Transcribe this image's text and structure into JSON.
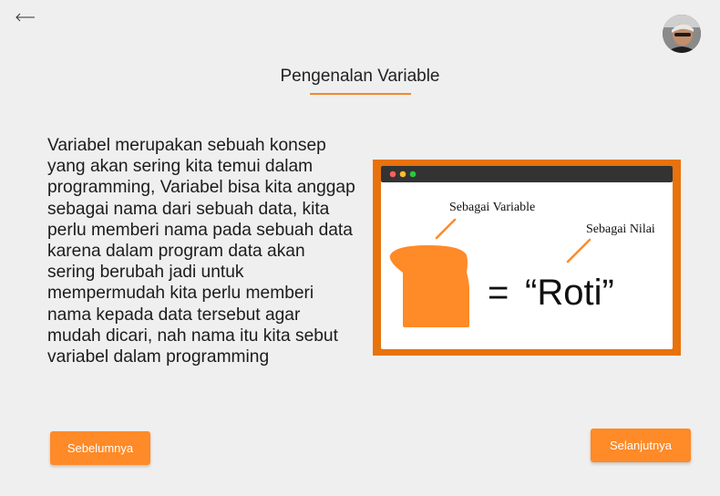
{
  "header": {
    "back_icon": "arrow-left-icon",
    "avatar_icon": "user-avatar"
  },
  "main": {
    "title": "Pengenalan Variable",
    "description": "Variabel merupakan sebuah konsep yang akan sering kita temui dalam programming, Variabel bisa kita anggap sebagai nama dari sebuah data, kita perlu memberi nama pada sebuah data karena dalam program data akan sering berubah jadi untuk mempermudah kita perlu memberi nama kepada data tersebut agar mudah dicari, nah nama itu kita sebut variabel dalam programming"
  },
  "illustration": {
    "label_variable": "Sebagai Variable",
    "label_value": "Sebagai Nilai",
    "equals": "=",
    "value_text": "“Roti”"
  },
  "navigation": {
    "prev_label": "Sebelumnya",
    "next_label": "Selanjutnya"
  },
  "colors": {
    "accent": "#fe8a28",
    "frame_border": "#e8720c",
    "window_bar": "#333333",
    "background": "#efefef"
  }
}
